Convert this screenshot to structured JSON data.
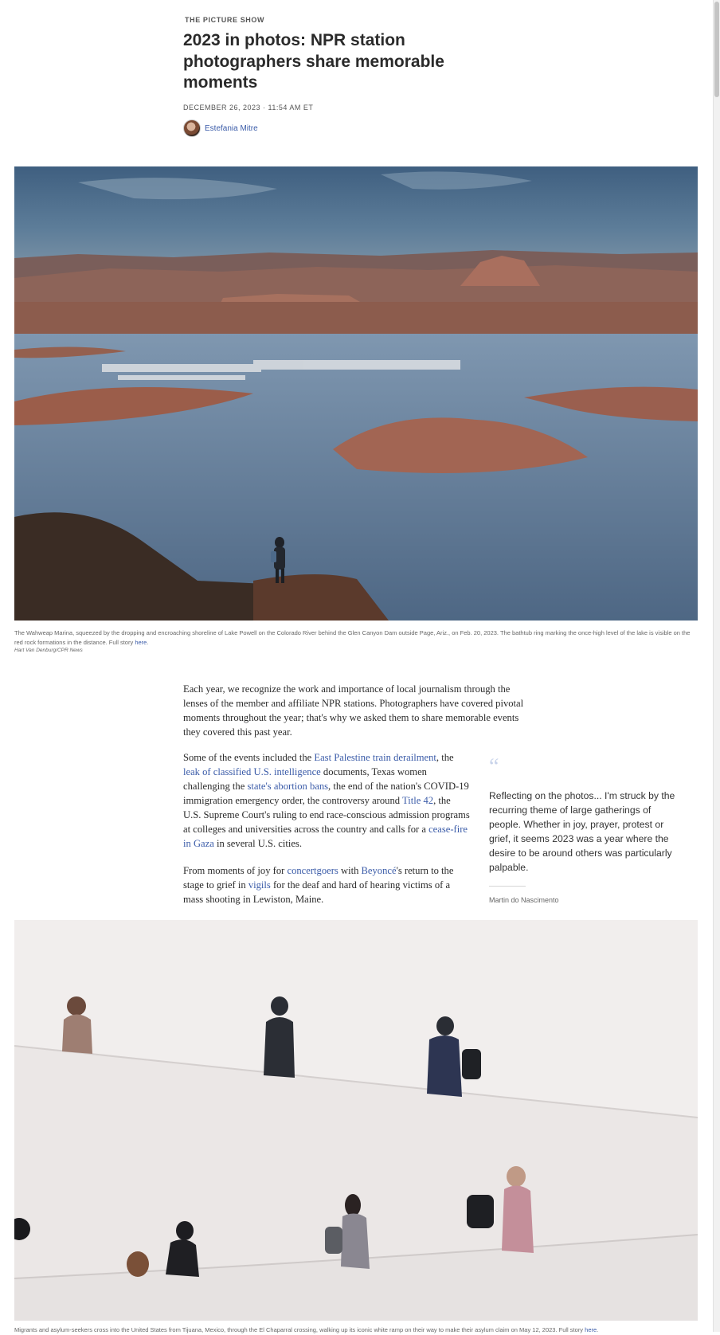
{
  "article": {
    "kicker": "THE PICTURE SHOW",
    "headline": "2023 in photos: NPR station photographers share memorable moments",
    "dateline": "DECEMBER 26, 2023 · 11:54 AM ET",
    "author": "Estefania Mitre"
  },
  "photo1": {
    "caption": "The Wahweap Marina, squeezed by the dropping and encroaching shoreline of Lake Powell on the Colorado River behind the Glen Canyon Dam outside Page, Ariz., on Feb. 20, 2023. The bathtub ring marking the once-high level of the lake is visible on the red rock formations in the distance. Full story ",
    "link": "here",
    "credit": "Hart Van Denburg/CPR News"
  },
  "body": {
    "p1": "Each year, we recognize the work and importance of local journalism through the lenses of the member and affiliate NPR stations. Photographers have covered pivotal moments throughout the year; that's why we asked them to share memorable events they covered this past year.",
    "p2": {
      "t1": "Some of the events included the ",
      "l1": "East Palestine train derailment",
      "t2": ", the ",
      "l2": "leak of classified U.S. intelligence",
      "t3": " documents, Texas women challenging the ",
      "l3": "state's abortion bans",
      "t4": ", the end of the nation's COVID-19 immigration emergency order, the controversy around ",
      "l4": "Title 42",
      "t5": ", the U.S. Supreme Court's ruling to end race-conscious admission programs at colleges and universities across the country and calls for a ",
      "l5": "cease-fire in Gaza",
      "t6": " in several U.S. cities."
    },
    "p3": {
      "t1": "From moments of joy for ",
      "l1": "concertgoers",
      "t2": " with ",
      "l2": "Beyoncé",
      "t3": "'s return to the stage to grief in ",
      "l3": "vigils",
      "t4": " for the deaf and hard of hearing victims of a mass shooting in Lewiston, Maine."
    }
  },
  "pullquote": {
    "mark": "“",
    "text": "Reflecting on the photos... I'm struck by the recurring theme of large gatherings of people. Whether in joy, prayer, protest or grief, it seems 2023 was a year where the desire to be around others was particularly palpable.",
    "attribution": "Martin do Nascimento"
  },
  "photo2": {
    "caption": "Migrants and asylum-seekers cross into the United States from Tijuana, Mexico, through the El Chaparral crossing, walking up its iconic white ramp on their way to make their asylum claim on May 12, 2023. Full story ",
    "link": "here"
  },
  "colors": {
    "link": "#3a5ba8",
    "text": "#2a2a2a",
    "quote_mark": "#c8d3ea"
  }
}
